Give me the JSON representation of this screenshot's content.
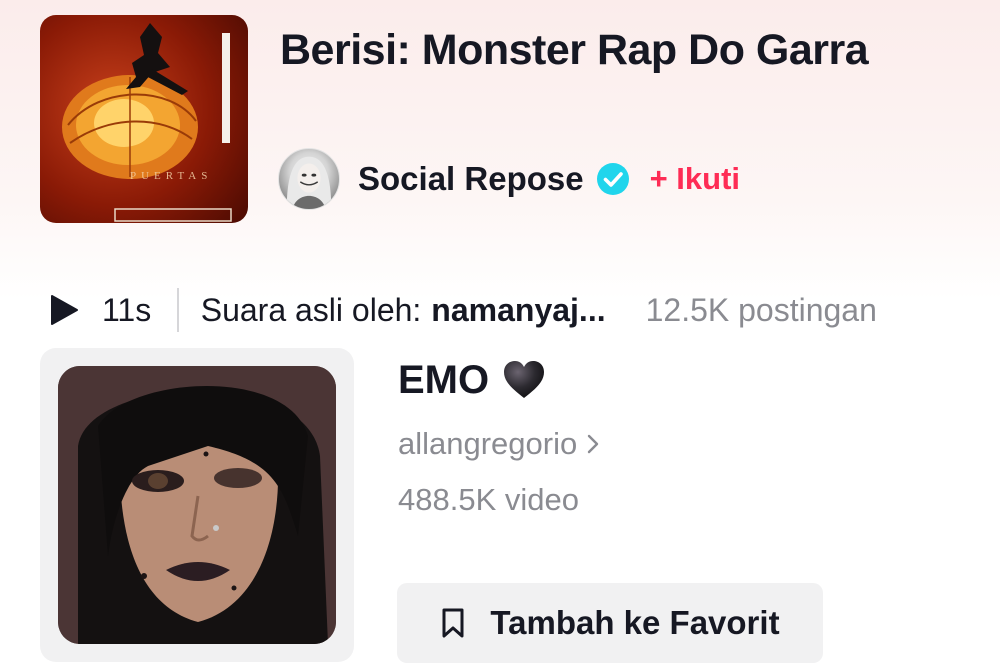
{
  "header": {
    "title": "Berisi: Monster Rap Do Garra",
    "cover_caption": "PUERTAS",
    "author": {
      "name": "Social Repose",
      "verified": true,
      "follow_label": "+ Ikuti"
    }
  },
  "sound": {
    "duration": "11s",
    "prefix": "Suara asli oleh:",
    "name": "namanyaj...",
    "posts": "12.5K postingan"
  },
  "item": {
    "title": "EMO",
    "emoji": "black-heart",
    "author": "allangregorio",
    "count": "488.5K video",
    "favorite_label": "Tambah ke Favorit"
  },
  "colors": {
    "accent": "#fe2c55",
    "verified": "#20d5ec",
    "text": "#161823",
    "muted": "#8a8b91",
    "button_bg": "#f1f1f2"
  },
  "icons": [
    "verified-badge-icon",
    "play-icon",
    "black-heart-icon",
    "chevron-right-icon",
    "bookmark-icon"
  ]
}
